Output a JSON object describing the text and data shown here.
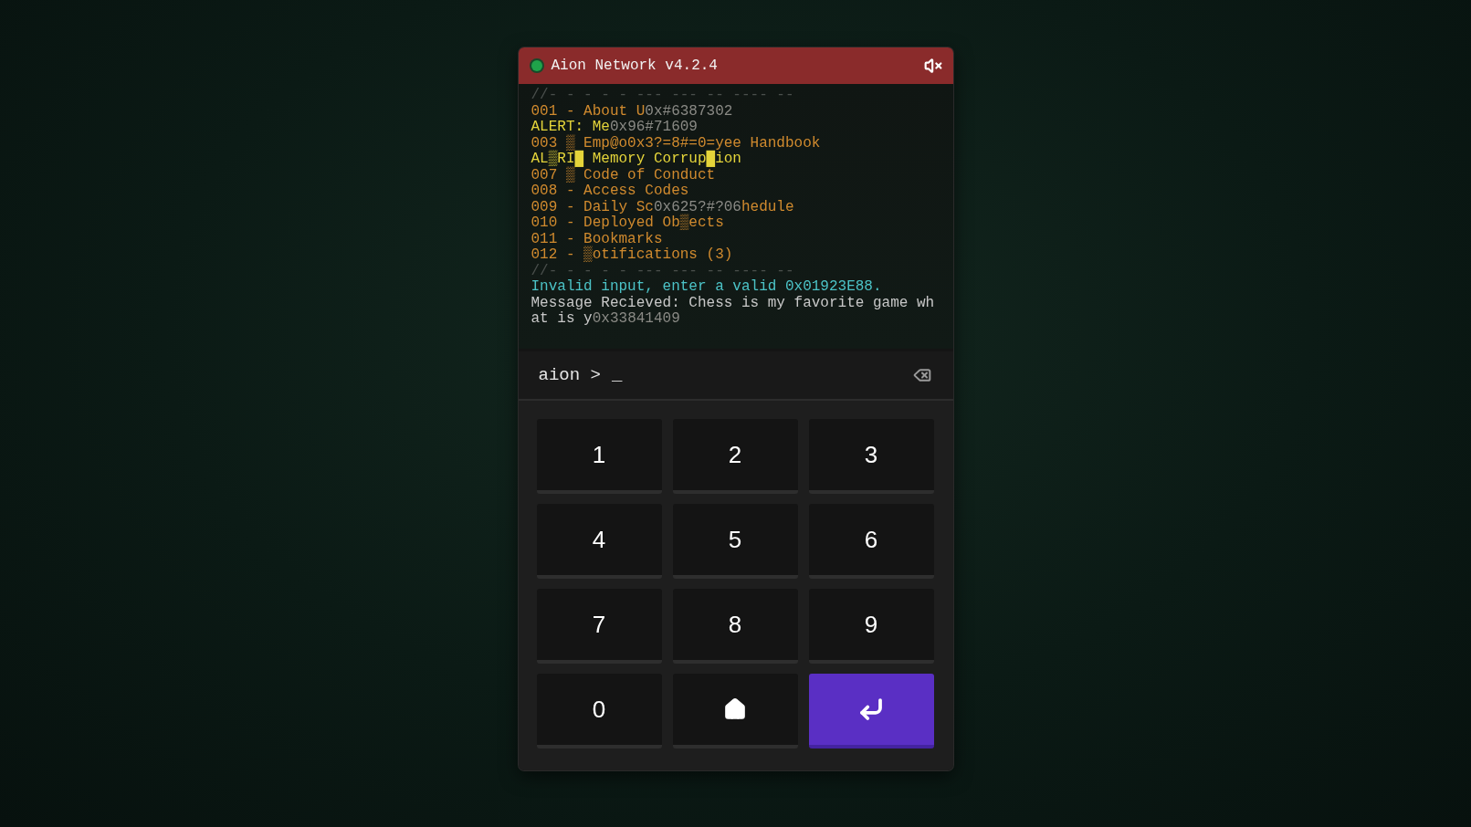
{
  "window": {
    "title": "Aion Network v4.2.4",
    "muted": true
  },
  "terminal": {
    "lines": [
      [
        {
          "text": "//- - - - - --- --- -- ---- --",
          "color": "#4a4f4c"
        }
      ],
      [
        {
          "text": "001 - About U",
          "color": "#d08a2e"
        },
        {
          "text": "0x#6387302",
          "color": "#8a8a85"
        }
      ],
      [
        {
          "text": "ALERT: Me",
          "color": "#e4d43a"
        },
        {
          "text": "0x96#71609",
          "color": "#8a8a85"
        }
      ],
      [
        {
          "text": "003 ▒ Emp@o0x3?=8#=0=yee Handbook",
          "color": "#d08a2e"
        }
      ],
      [
        {
          "text": "AL▒RI█ Memory Corrup█ion",
          "color": "#e4d43a"
        }
      ],
      [
        {
          "text": "007 ▒ Code of Conduct",
          "color": "#d08a2e"
        }
      ],
      [
        {
          "text": "008 - Access Codes",
          "color": "#d08a2e"
        }
      ],
      [
        {
          "text": "009 - Daily Sc",
          "color": "#d08a2e"
        },
        {
          "text": "0x625?#?06",
          "color": "#8a8a85"
        },
        {
          "text": "hedule",
          "color": "#d08a2e"
        }
      ],
      [
        {
          "text": "010 - Deployed Ob▒ects",
          "color": "#d08a2e"
        }
      ],
      [
        {
          "text": "011 - Bookmarks",
          "color": "#d08a2e"
        }
      ],
      [
        {
          "text": "012 - ▒otifications (3)",
          "color": "#d08a2e"
        }
      ],
      [
        {
          "text": "//- - - - - --- --- -- ---- --",
          "color": "#4a4f4c"
        }
      ],
      [
        {
          "text": "Invalid input, enter a valid 0x01923E88.",
          "color": "#4cc3c7"
        }
      ],
      [
        {
          "text": "Message Recieved: Chess is my favorite game wh",
          "color": "#c8c8c8"
        }
      ],
      [
        {
          "text": "at is y",
          "color": "#c8c8c8"
        },
        {
          "text": "0x33841409",
          "color": "#8a8a85"
        }
      ]
    ]
  },
  "prompt": {
    "label": "aion >",
    "value": "_"
  },
  "keys": [
    {
      "kind": "digit",
      "label": "1"
    },
    {
      "kind": "digit",
      "label": "2"
    },
    {
      "kind": "digit",
      "label": "3"
    },
    {
      "kind": "digit",
      "label": "4"
    },
    {
      "kind": "digit",
      "label": "5"
    },
    {
      "kind": "digit",
      "label": "6"
    },
    {
      "kind": "digit",
      "label": "7"
    },
    {
      "kind": "digit",
      "label": "8"
    },
    {
      "kind": "digit",
      "label": "9"
    },
    {
      "kind": "digit",
      "label": "0"
    },
    {
      "kind": "home"
    },
    {
      "kind": "enter"
    }
  ]
}
